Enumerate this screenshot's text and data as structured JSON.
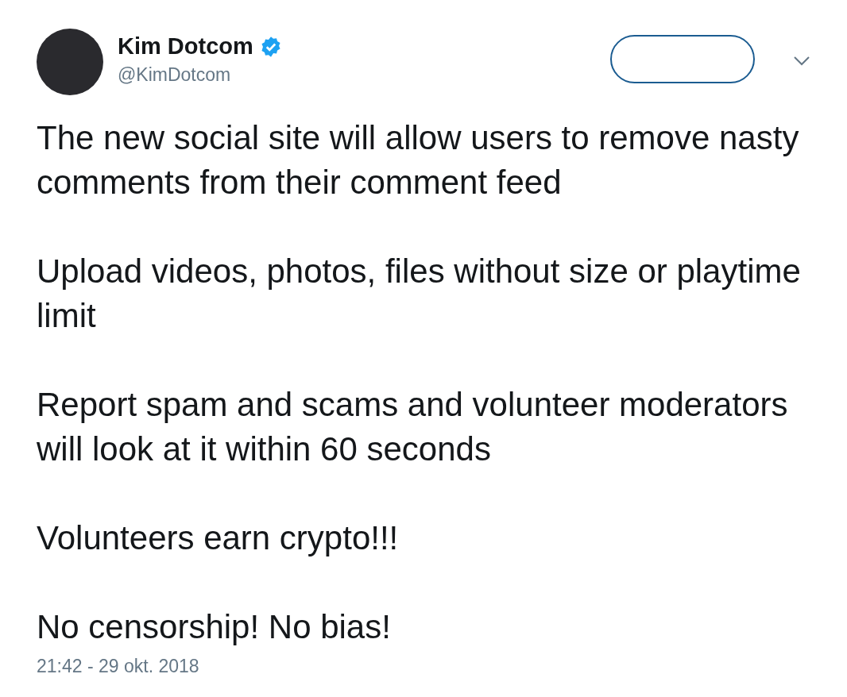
{
  "author": {
    "name": "Kim Dotcom",
    "handle": "@KimDotcom",
    "verified": true
  },
  "paragraphs": [
    "The new social site will allow users to remove nasty comments from their comment feed",
    "Upload videos, photos, files without size or playtime limit",
    "Report spam and scams and volunteer moderators will look at it within 60 seconds",
    "Volunteers earn crypto!!!",
    "No censorship! No bias!"
  ],
  "timestamp": "21:42 - 29 okt. 2018"
}
